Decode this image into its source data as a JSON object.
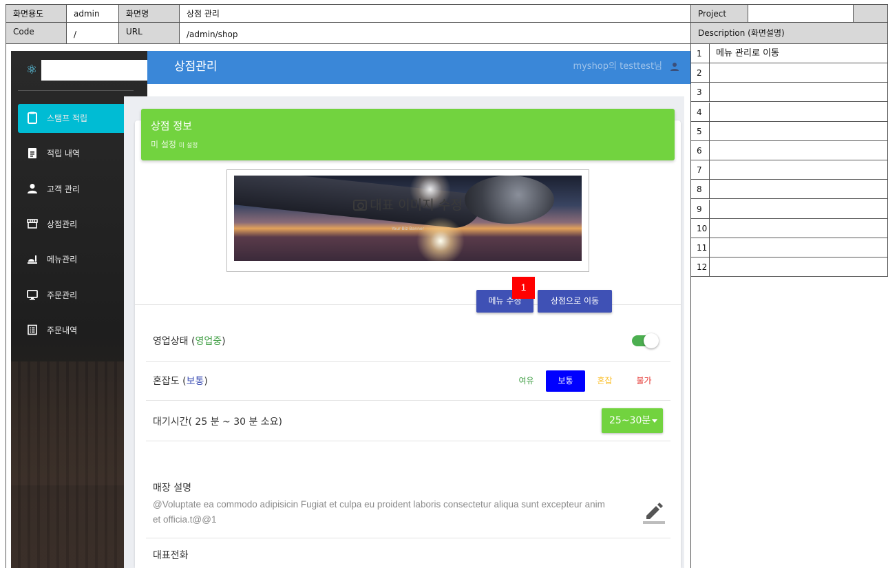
{
  "spec": {
    "screen_usage_label": "화면용도",
    "screen_usage_value": "admin",
    "screen_name_label": "화면명",
    "screen_name_value": "상점 관리",
    "project_label": "Project",
    "project_value": "",
    "code_label": "Code",
    "code_value": "/",
    "url_label": "URL",
    "url_value": "/admin/shop",
    "description_label": "Description (화면설명)"
  },
  "descriptions": [
    {
      "num": "1",
      "text": "메뉴 관리로 이동"
    },
    {
      "num": "2",
      "text": ""
    },
    {
      "num": "3",
      "text": ""
    },
    {
      "num": "4",
      "text": ""
    },
    {
      "num": "5",
      "text": ""
    },
    {
      "num": "6",
      "text": ""
    },
    {
      "num": "7",
      "text": ""
    },
    {
      "num": "8",
      "text": ""
    },
    {
      "num": "9",
      "text": ""
    },
    {
      "num": "10",
      "text": ""
    },
    {
      "num": "11",
      "text": ""
    },
    {
      "num": "12",
      "text": ""
    }
  ],
  "sidebar": {
    "items": [
      {
        "label": "스탬프 적립",
        "icon": "clipboard-icon",
        "active": true
      },
      {
        "label": "적립 내역",
        "icon": "assignment-icon",
        "active": false
      },
      {
        "label": "고객 관리",
        "icon": "person-icon",
        "active": false
      },
      {
        "label": "상점관리",
        "icon": "store-icon",
        "active": false
      },
      {
        "label": "메뉴관리",
        "icon": "food-icon",
        "active": false
      },
      {
        "label": "주문관리",
        "icon": "monitor-icon",
        "active": false
      },
      {
        "label": "주문내역",
        "icon": "list-icon",
        "active": false
      }
    ]
  },
  "topbar": {
    "title": "상점관리",
    "user": "myshop의 testtest님"
  },
  "shop_info": {
    "title": "상점 정보",
    "subtitle": "미 설정",
    "subtitle_small": "미 설정"
  },
  "banner": {
    "caption": "대표 이미지 수정",
    "tiny_text": "Your Biz Banner"
  },
  "buttons": {
    "menu_edit": "메뉴 수정",
    "go_shop": "상점으로 이동",
    "badge": "1"
  },
  "status": {
    "label": "영업상태",
    "open_paren": "(",
    "value": "영업중",
    "close_paren": ")",
    "on": true
  },
  "congestion": {
    "label": "혼잡도",
    "open_paren": "(",
    "value": "보통",
    "close_paren": ")",
    "options": [
      "여유",
      "보통",
      "혼잡",
      "불가"
    ],
    "colors": [
      "#43a047",
      "#ffffff",
      "#fbc02d",
      "#e53935"
    ],
    "selected_bg": "#0000ff"
  },
  "wait": {
    "label": "대기시간( 25 분 ~ 30 분 소요)",
    "selected": "25~30분"
  },
  "store_desc": {
    "label": "매장 설명",
    "text": "@Voluptate ea commodo adipisicin Fugiat et culpa eu proident laboris consectetur aliqua sunt excepteur anim et officia.t@@1"
  },
  "phone": {
    "label": "대표전화"
  },
  "colors": {
    "topbar": "#3a87d8",
    "green": "#72d33f",
    "indigo": "#3f51b5",
    "cyan": "#00bcd4",
    "badge": "#ff0000"
  }
}
